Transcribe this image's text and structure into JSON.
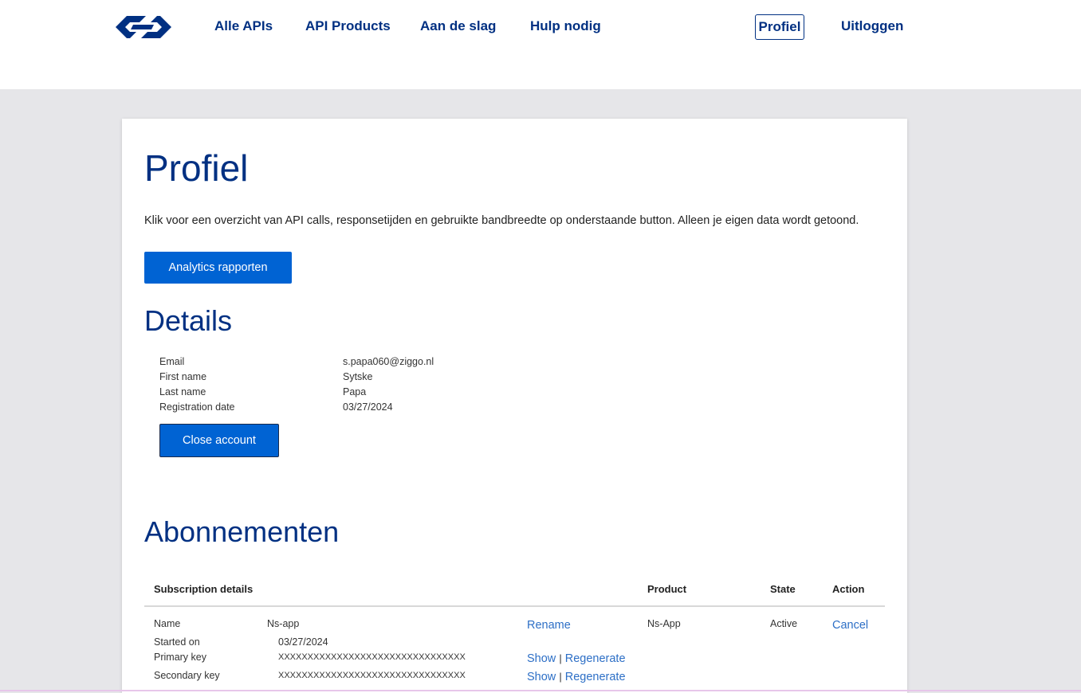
{
  "nav": {
    "items": [
      "Alle APIs",
      "API Products",
      "Aan de slag",
      "Hulp nodig"
    ],
    "profile": "Profiel",
    "logout": "Uitloggen"
  },
  "page": {
    "title": "Profiel",
    "intro": "Klik voor een overzicht van API calls, responsetijden en gebruikte bandbreedte op onderstaande button. Alleen je eigen data wordt getoond.",
    "analytics_button": "Analytics rapporten"
  },
  "details": {
    "heading": "Details",
    "rows": [
      {
        "label": "Email",
        "value": "s.papa060@ziggo.nl"
      },
      {
        "label": "First name",
        "value": "Sytske"
      },
      {
        "label": "Last name",
        "value": "Papa"
      },
      {
        "label": "Registration date",
        "value": "03/27/2024"
      }
    ],
    "close_button": "Close account"
  },
  "subscriptions": {
    "heading": "Abonnementen",
    "columns": [
      "Subscription details",
      "Product",
      "State",
      "Action"
    ],
    "row": {
      "name_label": "Name",
      "name_value": "Ns-app",
      "started_label": "Started on",
      "started_value": "03/27/2024",
      "primary_label": "Primary key",
      "primary_value": "XXXXXXXXXXXXXXXXXXXXXXXXXXXXXXXX",
      "secondary_label": "Secondary key",
      "secondary_value": "XXXXXXXXXXXXXXXXXXXXXXXXXXXXXXXX",
      "rename": "Rename",
      "show": "Show",
      "separator": "|",
      "regenerate": "Regenerate",
      "product": "Ns-App",
      "state": "Active",
      "action": "Cancel"
    }
  },
  "colors": {
    "brand": "#003082",
    "button": "#0063d3",
    "link": "#2d6fc6",
    "background": "#e6e6e9"
  }
}
